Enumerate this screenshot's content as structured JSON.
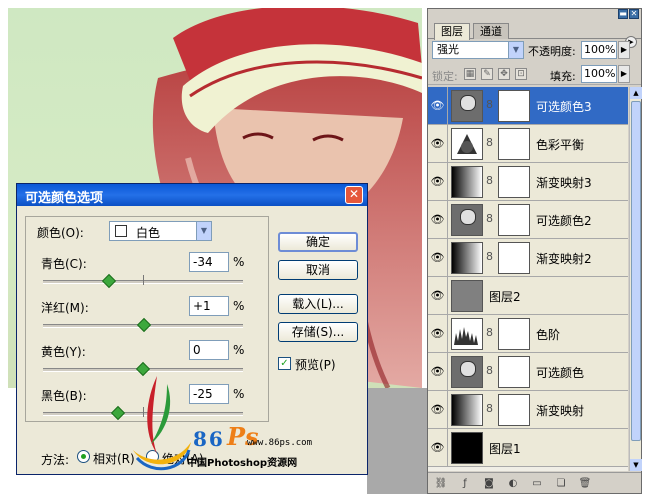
{
  "layers_panel": {
    "tabs": [
      "图层",
      "通道"
    ],
    "blend_mode": "强光",
    "opacity_label": "不透明度:",
    "opacity_value": "100%",
    "lock_label": "锁定:",
    "fill_label": "填充:",
    "fill_value": "100%",
    "layers": [
      {
        "name": "可选颜色3",
        "thumb": "selective-color",
        "mask": true,
        "selected": true
      },
      {
        "name": "色彩平衡",
        "thumb": "color-balance",
        "mask": true,
        "selected": false
      },
      {
        "name": "渐变映射3",
        "thumb": "gradient-map",
        "mask": true,
        "selected": false
      },
      {
        "name": "可选颜色2",
        "thumb": "selective-color",
        "mask": true,
        "selected": false
      },
      {
        "name": "渐变映射2",
        "thumb": "gradient-map",
        "mask": true,
        "selected": false
      },
      {
        "name": "图层2",
        "thumb": "gray",
        "mask": false,
        "selected": false
      },
      {
        "name": "色阶",
        "thumb": "levels",
        "mask": true,
        "selected": false
      },
      {
        "name": "可选颜色",
        "thumb": "selective-color",
        "mask": true,
        "selected": false
      },
      {
        "name": "渐变映射",
        "thumb": "gradient-map",
        "mask": true,
        "selected": false
      },
      {
        "name": "图层1",
        "thumb": "black",
        "mask": false,
        "selected": false
      }
    ]
  },
  "dialog": {
    "title": "可选颜色选项",
    "color_label": "颜色(O):",
    "color_value": "白色",
    "sliders": [
      {
        "label": "青色(C):",
        "value": "-34",
        "unit": "%",
        "level": -34
      },
      {
        "label": "洋红(M):",
        "value": "+1",
        "unit": "%",
        "level": 1
      },
      {
        "label": "黄色(Y):",
        "value": "0",
        "unit": "%",
        "level": 0
      },
      {
        "label": "黑色(B):",
        "value": "-25",
        "unit": "%",
        "level": -25
      }
    ],
    "buttons": {
      "ok": "确定",
      "cancel": "取消",
      "load": "载入(L)...",
      "save": "存储(S)..."
    },
    "preview_label": "预览(P)",
    "preview_checked": true,
    "method_label": "方法:",
    "method_relative": "相对(R)",
    "method_absolute": "绝对(A)",
    "method_selected": "relative"
  },
  "watermark": {
    "brand_number": "86",
    "brand_letters": "Ps",
    "url": "www.86ps.com",
    "site_name": "中国Photoshop资源网"
  },
  "colors": {
    "selection": "#316ac5",
    "titlebar": "#0a58d6",
    "photo_tint": "#cfe8c2",
    "photo_red": "#c8242c"
  }
}
